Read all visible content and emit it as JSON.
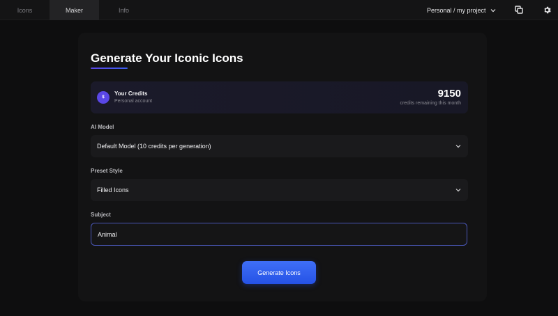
{
  "nav": {
    "tabs": [
      {
        "label": "Icons",
        "active": false
      },
      {
        "label": "Maker",
        "active": true
      },
      {
        "label": "Info",
        "active": false
      }
    ],
    "project_label": "Personal / my project"
  },
  "header": {
    "title": "Generate Your Iconic Icons"
  },
  "credits": {
    "badge": "$",
    "label": "Your Credits",
    "account": "Personal account",
    "count": "9150",
    "count_caption": "credits remaining this month"
  },
  "form": {
    "model_label": "AI Model",
    "model_value": "Default Model (10 credits per generation)",
    "style_label": "Preset Style",
    "style_value": "Filled Icons",
    "subject_label": "Subject",
    "subject_value": "Animal",
    "subject_placeholder": ""
  },
  "actions": {
    "generate_label": "Generate Icons"
  },
  "colors": {
    "accent": "#3f6ff7",
    "badge": "#5a47e8",
    "background": "#0e0e0f"
  }
}
